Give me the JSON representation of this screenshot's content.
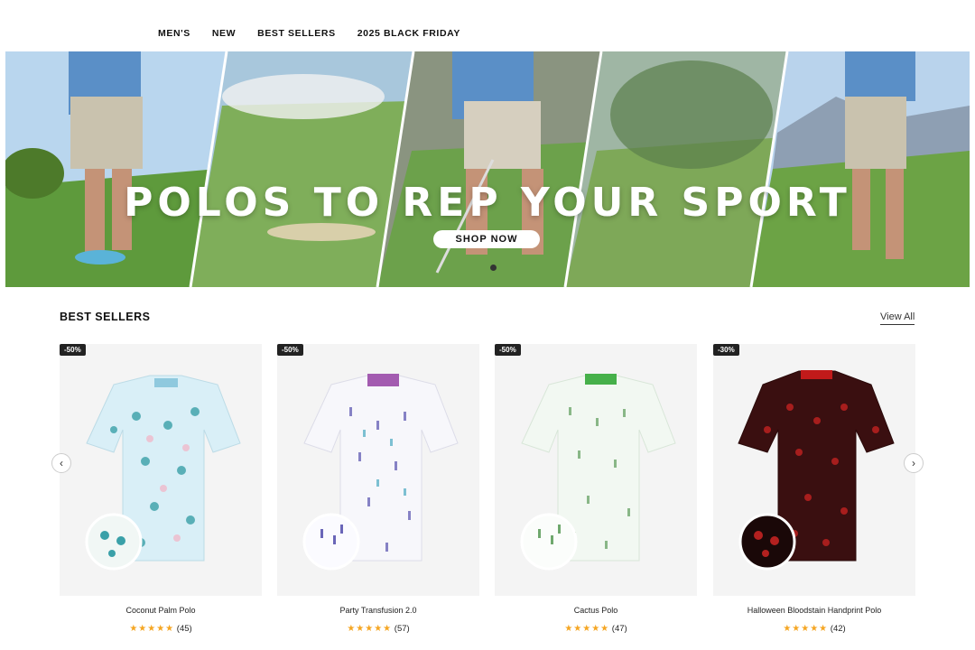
{
  "nav": {
    "items": [
      "MEN'S",
      "NEW",
      "BEST SELLERS",
      "2025 BLACK FRIDAY"
    ]
  },
  "hero": {
    "title": "POLOS TO REP YOUR SPORT",
    "button": "SHOP NOW"
  },
  "section": {
    "title": "BEST SELLERS",
    "view_all": "View All"
  },
  "products": [
    {
      "badge": "-50%",
      "name": "Coconut Palm Polo",
      "stars": "★★★★★",
      "reviews": "(45)"
    },
    {
      "badge": "-50%",
      "name": "Party Transfusion 2.0",
      "stars": "★★★★★",
      "reviews": "(57)"
    },
    {
      "badge": "-50%",
      "name": "Cactus Polo",
      "stars": "★★★★★",
      "reviews": "(47)"
    },
    {
      "badge": "-30%",
      "name": "Halloween Bloodstain Handprint Polo",
      "stars": "★★★★★",
      "reviews": "(42)"
    }
  ],
  "carousel": {
    "prev_icon": "‹",
    "next_icon": "›"
  }
}
